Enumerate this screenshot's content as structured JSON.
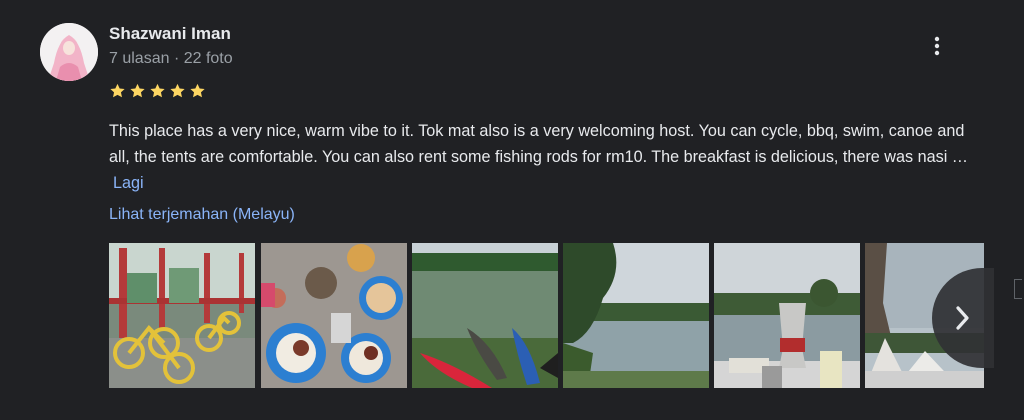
{
  "reviewer": {
    "name": "Shazwani Iman",
    "meta": "7 ulasan · 22 foto"
  },
  "rating": {
    "value": 5,
    "max": 5,
    "star_color": "#fdd663"
  },
  "review": {
    "text": "This place has a very nice, warm vibe to it. Tok mat also is a very welcoming host. You can cycle, bbq, swim, canoe and all, the tents are comfortable. You can also rent some fishing rods for rm10. The breakfast is delicious, there was nasi …",
    "more_label": "Lagi",
    "translate_label": "Lihat terjemahan (Melayu)"
  },
  "photos": [
    {
      "subject": "yellow-bicycles"
    },
    {
      "subject": "breakfast-table"
    },
    {
      "subject": "pond-with-canoes"
    },
    {
      "subject": "pond-landscape"
    },
    {
      "subject": "coffee-pot-by-pond"
    },
    {
      "subject": "tents-by-lake"
    }
  ],
  "icons": {
    "more": "more-vert-icon",
    "next": "chevron-right-icon"
  },
  "colors": {
    "background": "#202124",
    "text": "#e8eaed",
    "secondary_text": "#9aa0a6",
    "link": "#8ab4f8"
  }
}
